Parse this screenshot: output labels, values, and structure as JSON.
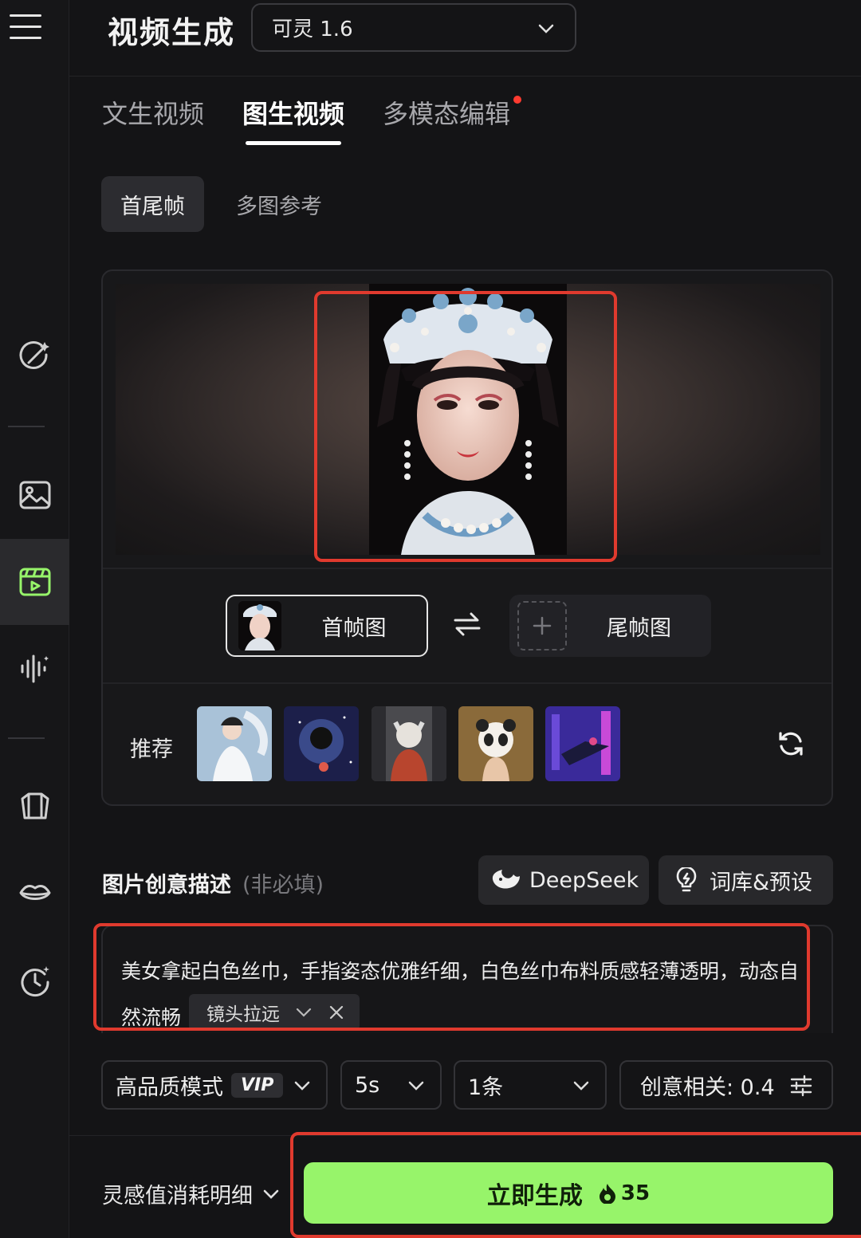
{
  "header": {
    "title": "视频生成",
    "model": "可灵 1.6"
  },
  "tabs": [
    {
      "label": "文生视频"
    },
    {
      "label": "图生视频"
    },
    {
      "label": "多模态编辑"
    }
  ],
  "subtabs": [
    {
      "label": "首尾帧"
    },
    {
      "label": "多图参考"
    }
  ],
  "frames": {
    "first": "首帧图",
    "last": "尾帧图"
  },
  "recommend": {
    "label": "推荐"
  },
  "description": {
    "title": "图片创意描述",
    "hint": "(非必填)",
    "deepseek": "DeepSeek",
    "lexicon": "词库&预设",
    "text_line1": "美女拿起白色丝巾，手指姿态优雅纤细，白色丝巾布料质感轻薄透明，动态自",
    "text_line2": "然流畅",
    "tag": "镜头拉远"
  },
  "options": {
    "quality": "高品质模式",
    "vip": "VIP",
    "duration": "5s",
    "count": "1条",
    "creativity": "创意相关: 0.4"
  },
  "footer": {
    "cost_label": "灵感值消耗明细",
    "generate": "立即生成",
    "credits": "35"
  },
  "colors": {
    "accent_green": "#97f46a",
    "highlight_red": "#e03a2e",
    "notice_dot": "#ff3b30"
  }
}
